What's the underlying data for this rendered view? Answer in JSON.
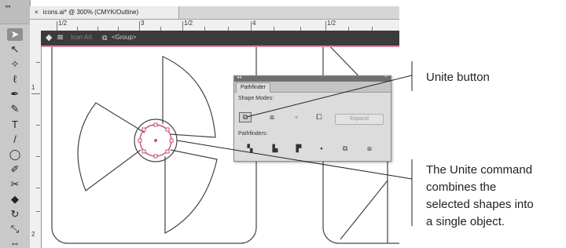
{
  "document": {
    "tab_close": "×",
    "tab_title": "icons.ai* @ 300% (CMYK/Outline)"
  },
  "ruler": {
    "h_labels": [
      "1/2",
      "3",
      "1/2",
      "4",
      "1/2"
    ],
    "v_labels": [
      "1",
      "2"
    ]
  },
  "control_bar": {
    "selection_label": "Icon Art",
    "group_label": "<Group>"
  },
  "tools": {
    "items": [
      {
        "name": "selection",
        "glyph": "➤"
      },
      {
        "name": "direct-selection",
        "glyph": "↖"
      },
      {
        "name": "magic-wand",
        "glyph": "✧"
      },
      {
        "name": "lasso",
        "glyph": "ℓ"
      },
      {
        "name": "pen",
        "glyph": "✒"
      },
      {
        "name": "curvature",
        "glyph": "✎"
      },
      {
        "name": "type",
        "glyph": "T"
      },
      {
        "name": "line-segment",
        "glyph": "/"
      },
      {
        "name": "ellipse",
        "glyph": "◯"
      },
      {
        "name": "paintbrush",
        "glyph": "✐"
      },
      {
        "name": "shaper",
        "glyph": "✂"
      },
      {
        "name": "eraser",
        "glyph": "◆"
      },
      {
        "name": "rotate",
        "glyph": "↻"
      },
      {
        "name": "scale",
        "glyph": "⤡"
      },
      {
        "name": "width",
        "glyph": "⇔"
      }
    ]
  },
  "pathfinder": {
    "tab_label": "Pathfinder",
    "shape_modes_label": "Shape Modes:",
    "pathfinders_label": "Pathfinders:",
    "expand_label": "Expand"
  },
  "callouts": {
    "unite_button": "Unite button",
    "unite_command": [
      "The Unite command",
      "combines the",
      "selected shapes into",
      "a single object."
    ]
  },
  "colors": {
    "selection_highlight": "#c8507f",
    "control_bar": "#3b3b3b",
    "panel_bg": "#dcdcdc"
  }
}
